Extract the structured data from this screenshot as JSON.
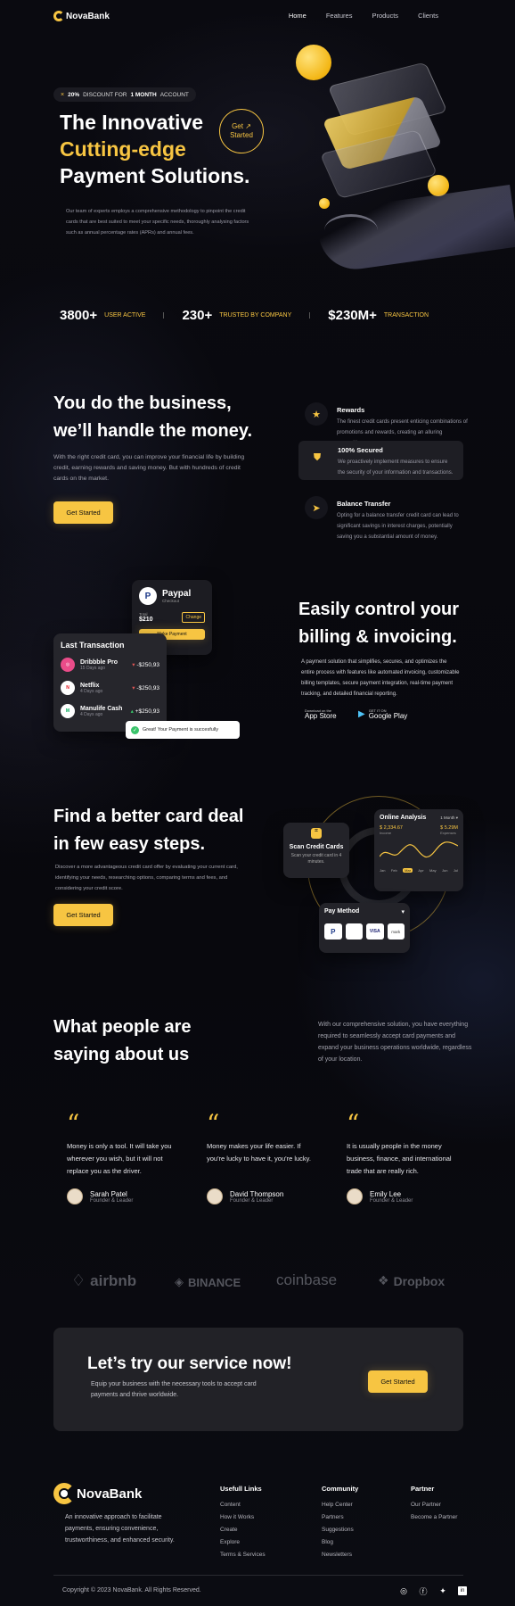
{
  "brand": {
    "name": "NovaBank"
  },
  "nav": {
    "items": [
      "Home",
      "Features",
      "Products",
      "Clients"
    ]
  },
  "hero": {
    "badge_pct": "20%",
    "badge_pre": "DISCOUNT FOR",
    "badge_bold": "1 MONTH",
    "badge_post": "ACCOUNT",
    "title_1": "The Innovative",
    "title_2": "Cutting-edge",
    "title_3": "Payment Solutions.",
    "cta": "Get Started",
    "cta_1": "Get",
    "cta_2": "Started",
    "description": "Our team of experts employs a comprehensive methodology to pinpoint the credit cards that are best suited to meet your specific needs, thoroughly analysing factors such as annual percentage rates (APRs) and annual fees."
  },
  "stats": [
    {
      "value": "3800+",
      "label": "USER ACTIVE"
    },
    {
      "value": "230+",
      "label": "TRUSTED BY COMPANY"
    },
    {
      "value": "$230M+",
      "label": "TRANSACTION"
    }
  ],
  "business": {
    "title_1": "You do the business,",
    "title_2": "we’ll handle the money.",
    "description": "With the right credit card, you can improve your financial life by building credit, earning rewards and saving money. But with hundreds of credit cards on the market.",
    "cta": "Get Started",
    "features": [
      {
        "icon": "star-icon",
        "title": "Rewards",
        "description": "The finest credit cards present enticing combinations of promotions and rewards, creating an alluring proposition."
      },
      {
        "icon": "shield-icon",
        "title": "100% Secured",
        "description": "We proactively implement measures to ensure the security of your information and transactions."
      },
      {
        "icon": "send-icon",
        "title": "Balance Transfer",
        "description": "Opting for a balance transfer credit card can lead to significant savings in interest charges, potentially saving you a substantial amount of money."
      }
    ]
  },
  "billing": {
    "title_1": "Easily control your",
    "title_2": "billing & invoicing.",
    "description": "A payment solution that simplifies, secures, and optimizes the entire process with features like automated invoicing, customizable billing templates, secure payment integration, real-time payment tracking, and detailed financial reporting.",
    "appstore_small": "Download on the",
    "appstore": "App Store",
    "googleplay_small": "GET IT ON",
    "googleplay": "Google Play",
    "paypal": {
      "name": "Paypal",
      "sub": "Checkout",
      "total_label": "Total",
      "total": "$210",
      "change": "Change",
      "make": "Make Payment"
    },
    "last_tx": {
      "title": "Last Transaction",
      "rows": [
        {
          "name": "Dribbble Pro",
          "date": "15 Days ago",
          "amount": "-$250,93",
          "dir": "down"
        },
        {
          "name": "Netflix",
          "date": "4 Days ago",
          "amount": "-$250,93",
          "dir": "down"
        },
        {
          "name": "Manulife Cash",
          "date": "4 Days ago",
          "amount": "+$250,93",
          "dir": "up"
        }
      ]
    },
    "toast": "Great! Your Payment is succesfully"
  },
  "steps": {
    "title_1": "Find a better card deal",
    "title_2": "in few easy steps.",
    "description": "Discover a more advantageous credit card offer by evaluating your current card, identifying your needs, researching options, comparing terms and fees, and considering your credit score.",
    "cta": "Get Started",
    "scan": {
      "title": "Scan Credit Cards",
      "sub": "Scan your credit card in 4 minutes."
    },
    "analysis": {
      "title": "Online Analysis",
      "period": "1 Month",
      "income": "$ 2,334.67",
      "income_label": "Income",
      "expenses": "$ 5.29M",
      "expenses_label": "Expenses",
      "months": [
        "Jan",
        "Feb",
        "Mar",
        "Apr",
        "May",
        "Jun",
        "Jul"
      ],
      "active_month": "Mar"
    },
    "pay": {
      "title": "Pay Method",
      "methods": [
        "P",
        "",
        "VISA",
        "mark"
      ]
    }
  },
  "testimonials": {
    "title_1": "What people are",
    "title_2": "saying about us",
    "description": "With our comprehensive solution, you have everything required to seamlessly accept card payments and expand your business operations worldwide, regardless of your location.",
    "items": [
      {
        "quote": "Money is only a tool. It will take you wherever you wish, but it will not replace you as the driver.",
        "name": "Sarah Patel",
        "role": "Founder & Leader"
      },
      {
        "quote": "Money makes your life easier. If you're lucky to have it, you're lucky.",
        "name": "David Thompson",
        "role": "Founder & Leader"
      },
      {
        "quote": "It is usually people in the money business, finance, and international trade that are really rich.",
        "name": "Emily Lee",
        "role": "Founder & Leader"
      }
    ]
  },
  "brands": [
    "airbnb",
    "BINANCE",
    "coinbase",
    "Dropbox"
  ],
  "cta": {
    "title": "Let’s try our service now!",
    "description": "Equip your business with the necessary tools to accept card payments and thrive worldwide.",
    "button": "Get Started"
  },
  "footer": {
    "tagline": "An innovative approach to facilitate payments, ensuring convenience, trustworthiness, and enhanced security.",
    "cols": [
      {
        "title": "Usefull Links",
        "items": [
          "Content",
          "How it Works",
          "Create",
          "Explore",
          "Terms & Services"
        ]
      },
      {
        "title": "Community",
        "items": [
          "Help Center",
          "Partners",
          "Suggestions",
          "Blog",
          "Newsletters"
        ]
      },
      {
        "title": "Partner",
        "items": [
          "Our Partner",
          "Become a Partner"
        ]
      }
    ],
    "copyright": "Copyright © 2023 NovaBank. All Rights Reserved."
  }
}
